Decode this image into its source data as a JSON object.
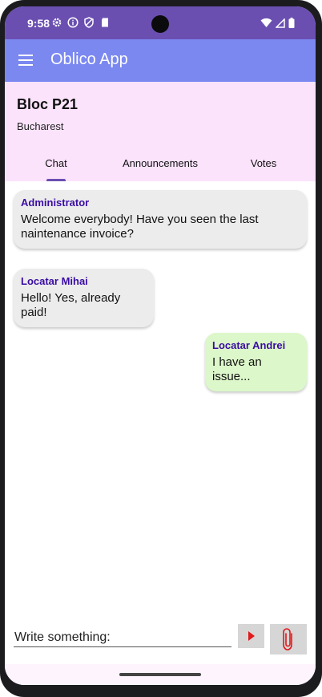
{
  "status_bar": {
    "time": "9:58",
    "left_icons": [
      "settings-icon",
      "info-icon",
      "shield-icon",
      "sd-card-icon"
    ],
    "right_icons": [
      "wifi-icon",
      "signal-icon",
      "battery-icon"
    ]
  },
  "app_bar": {
    "title": "Oblico App",
    "color": "#7b88f0"
  },
  "header": {
    "title": "Bloc P21",
    "subtitle": "Bucharest",
    "background": "#fbe3fb"
  },
  "tabs": [
    {
      "label": "Chat",
      "selected": true
    },
    {
      "label": "Announcements",
      "selected": false
    },
    {
      "label": "Votes",
      "selected": false
    }
  ],
  "messages": [
    {
      "author": "Administrator",
      "text": "Welcome everybody! Have you seen the last naintenance invoice?",
      "side": "left"
    },
    {
      "author": "Locatar Mihai",
      "text": "Hello! Yes, already paid!",
      "side": "left"
    },
    {
      "author": "Locatar Andrei",
      "text": "I have an issue...",
      "side": "right"
    }
  ],
  "composer": {
    "placeholder": "Write something:",
    "value": "",
    "send_icon": "play-arrow-icon",
    "attach_icon": "paperclip-icon"
  },
  "colors": {
    "accent": "#6a4fb1",
    "author_text": "#3a0ca3",
    "own_bubble": "#dcf7c9",
    "other_bubble": "#ececec",
    "send_arrow": "#e0191b"
  }
}
